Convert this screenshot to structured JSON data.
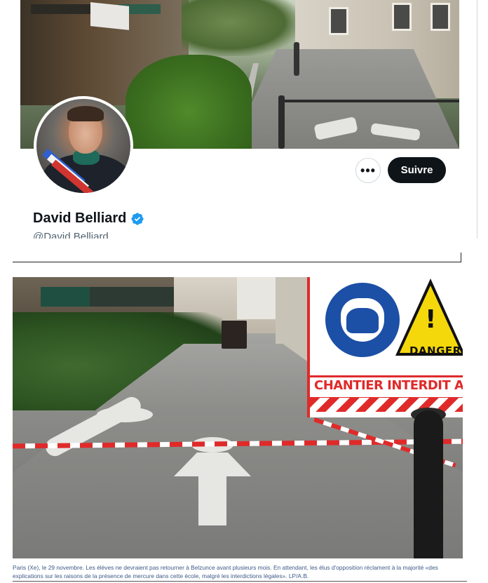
{
  "profile": {
    "display_name": "David Belliard",
    "handle": "@David Belliard",
    "verified": true,
    "follow_label": "Suivre",
    "more_label": "•••"
  },
  "colors": {
    "accent": "#1d9bf0",
    "button_dark": "#0f1419",
    "danger_red": "#e02a2a",
    "caption_blue": "#3d5a88"
  },
  "icons": {
    "verified": "verified-badge-icon",
    "more": "more-options-icon"
  },
  "photo": {
    "sign_danger": "DANGER",
    "sign_chantier": "CHANTIER INTERDIT A"
  },
  "caption": {
    "text": "Paris (Xe), le 29 novembre. Les élèves ne devraient pas retourner à Belzunce avant plusieurs mois. En attendant, les élus d'opposition réclament à la majorité «des explications sur les raisons de la présence de mercure dans cette école, malgré les interdictions légales». LP/A.B."
  }
}
